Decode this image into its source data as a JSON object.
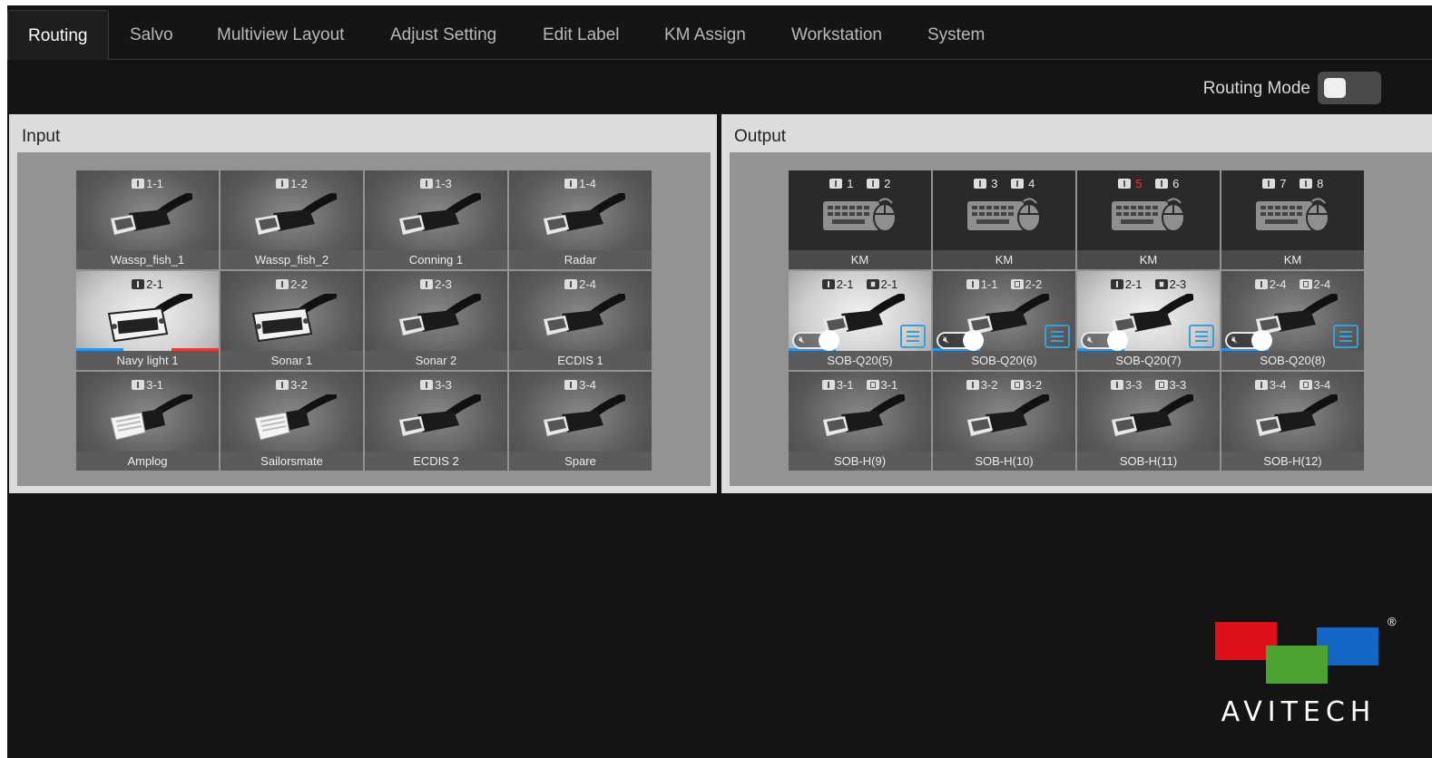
{
  "tabs": [
    {
      "label": "Routing",
      "active": true
    },
    {
      "label": "Salvo"
    },
    {
      "label": "Multiview Layout"
    },
    {
      "label": "Adjust Setting"
    },
    {
      "label": "Edit Label"
    },
    {
      "label": "KM Assign"
    },
    {
      "label": "Workstation"
    },
    {
      "label": "System"
    }
  ],
  "routing_mode": {
    "label": "Routing Mode",
    "on": false
  },
  "input": {
    "title": "Input",
    "tiles": [
      {
        "id": "1-1",
        "label": "Wassp_fish_1",
        "icon": "hdmi-cable-icon"
      },
      {
        "id": "1-2",
        "label": "Wassp_fish_2",
        "icon": "hdmi-cable-icon"
      },
      {
        "id": "1-3",
        "label": "Conning 1",
        "icon": "hdmi-cable-icon"
      },
      {
        "id": "1-4",
        "label": "Radar",
        "icon": "hdmi-cable-icon"
      },
      {
        "id": "2-1",
        "label": "Navy light 1",
        "icon": "dvi-cable-icon",
        "selected": true
      },
      {
        "id": "2-2",
        "label": "Sonar 1",
        "icon": "dvi-cable-icon"
      },
      {
        "id": "2-3",
        "label": "Sonar 2",
        "icon": "hdmi-cable-icon"
      },
      {
        "id": "2-4",
        "label": "ECDIS 1",
        "icon": "hdmi-cable-icon"
      },
      {
        "id": "3-1",
        "label": "Amplog",
        "icon": "ethernet-cable-icon"
      },
      {
        "id": "3-2",
        "label": "Sailorsmate",
        "icon": "ethernet-cable-icon"
      },
      {
        "id": "3-3",
        "label": "ECDIS 2",
        "icon": "hdmi-cable-icon"
      },
      {
        "id": "3-4",
        "label": "Spare",
        "icon": "hdmi-cable-icon"
      }
    ]
  },
  "output": {
    "title": "Output",
    "km_tiles": [
      {
        "a": "1",
        "b": "2",
        "label": "KM"
      },
      {
        "a": "3",
        "b": "4",
        "label": "KM"
      },
      {
        "a": "5",
        "b": "6",
        "label": "KM",
        "a_alert": true
      },
      {
        "a": "7",
        "b": "8",
        "label": "KM"
      }
    ],
    "tiles": [
      {
        "in": "2-1",
        "out": "2-1",
        "label": "SOB-Q20(5)",
        "controls": true,
        "highlight": true
      },
      {
        "in": "1-1",
        "out": "2-2",
        "label": "SOB-Q20(6)",
        "controls": true
      },
      {
        "in": "2-1",
        "out": "2-3",
        "label": "SOB-Q20(7)",
        "controls": true,
        "highlight": true
      },
      {
        "in": "2-4",
        "out": "2-4",
        "label": "SOB-Q20(8)",
        "controls": true
      },
      {
        "in": "3-1",
        "out": "3-1",
        "label": "SOB-H(9)"
      },
      {
        "in": "3-2",
        "out": "3-2",
        "label": "SOB-H(10)"
      },
      {
        "in": "3-3",
        "out": "3-3",
        "label": "SOB-H(11)"
      },
      {
        "in": "3-4",
        "out": "3-4",
        "label": "SOB-H(12)"
      }
    ]
  },
  "logo": {
    "text": "AVITECH",
    "reg": "®",
    "colors": {
      "red": "#e0101a",
      "green": "#4da32f",
      "blue": "#1466c4"
    }
  },
  "colors": {
    "accent_blue": "#2196f3",
    "accent_red": "#e53935",
    "menu_blue": "#3a9fd6"
  }
}
